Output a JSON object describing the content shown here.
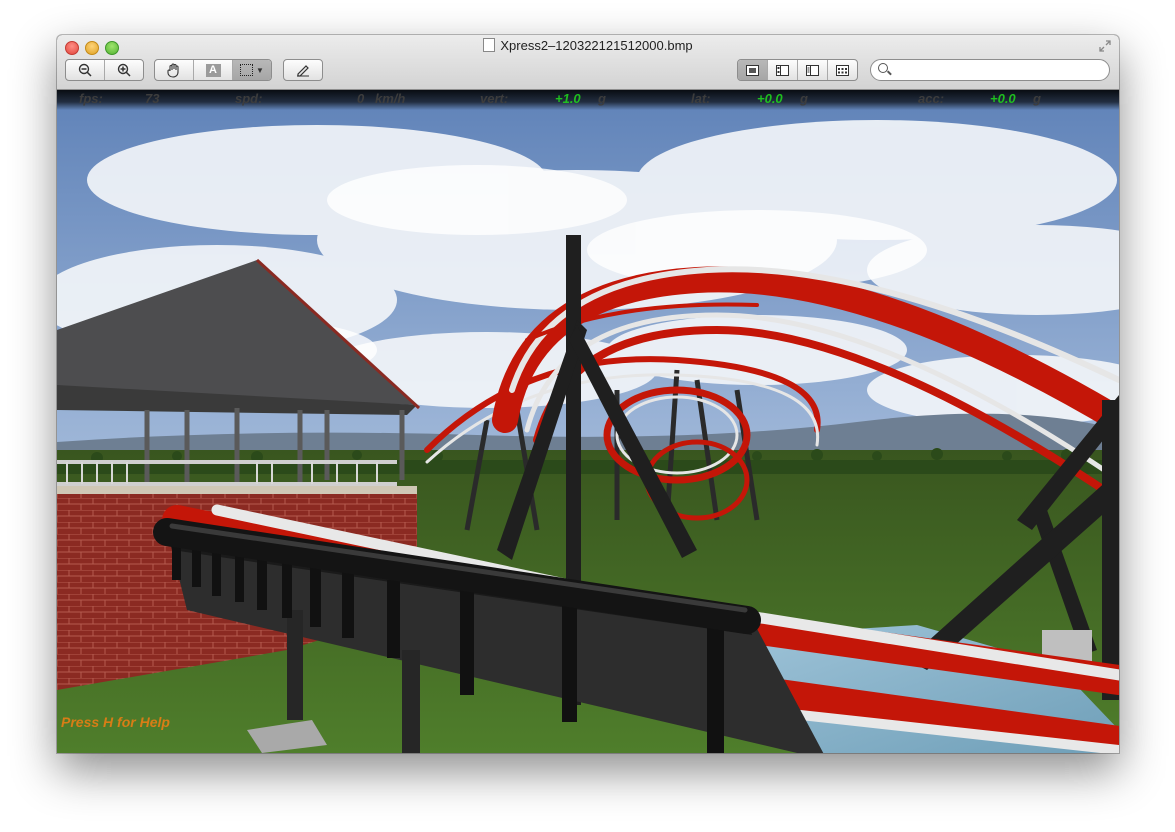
{
  "window": {
    "title": "Xpress2–120322121512000.bmp"
  },
  "toolbar": {
    "zoom_out_icon": "zoom-out-icon",
    "zoom_in_icon": "zoom-in-icon",
    "tools": [
      "hand-icon",
      "text-select-icon",
      "rect-select-icon"
    ],
    "annotate_icon": "pencil-icon",
    "view_modes": [
      "content-only-icon",
      "thumbnails-icon",
      "table-of-contents-icon",
      "contact-sheet-icon"
    ],
    "search_placeholder": ""
  },
  "hud": {
    "fps_label": "fps:",
    "fps_value": "73",
    "spd_label": "spd:",
    "spd_value": "0",
    "spd_unit": "km/h",
    "vert_label": "vert:",
    "vert_value": "+1.0",
    "vert_unit": "g",
    "lat_label": "lat:",
    "lat_value": "+0.0",
    "lat_unit": "g",
    "acc_label": "acc:",
    "acc_value": "+0.0",
    "acc_unit": "g"
  },
  "help_text": "Press H for Help",
  "colors": {
    "track_red": "#c41608",
    "rail_white": "#e6e6e6",
    "support_black": "#222222",
    "grass": "#3f6a22",
    "hud_green": "#1fbf1f",
    "help_orange": "#d87d16"
  }
}
